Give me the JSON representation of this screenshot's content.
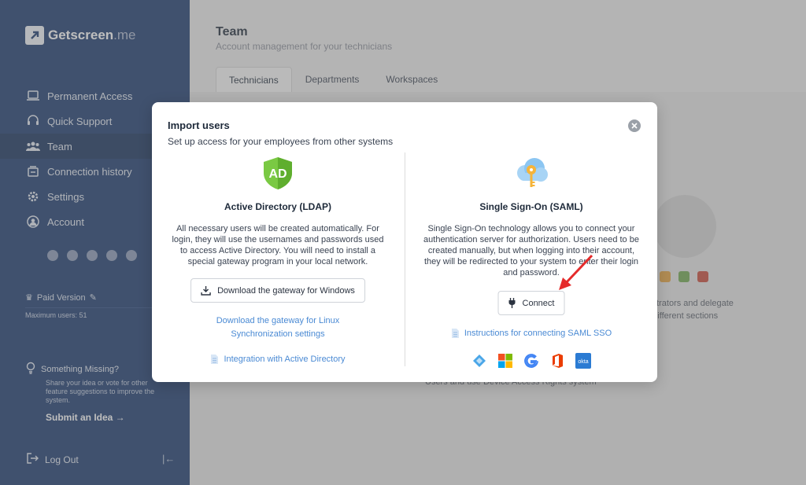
{
  "brand": {
    "name": "Getscreen",
    "suffix": ".me"
  },
  "sidebar": {
    "items": [
      {
        "label": "Permanent Access",
        "icon": "laptop-icon"
      },
      {
        "label": "Quick Support",
        "icon": "headset-icon"
      },
      {
        "label": "Team",
        "icon": "team-icon"
      },
      {
        "label": "Connection history",
        "icon": "history-icon"
      },
      {
        "label": "Settings",
        "icon": "gear-icon"
      },
      {
        "label": "Account",
        "icon": "user-circle-icon"
      }
    ],
    "paid_version": "Paid Version",
    "max_users": "Maximum users: 51",
    "missing_title": "Something Missing?",
    "missing_desc": "Share your idea or vote for other feature suggestions to improve the system.",
    "submit_idea": "Submit an Idea →",
    "logout": "Log Out"
  },
  "main": {
    "title": "Team",
    "subtitle": "Account management for your technicians",
    "tabs": [
      "Technicians",
      "Departments",
      "Workspaces"
    ],
    "bg_line1": "nistrators and delegate",
    "bg_line2": "n different sections",
    "bg_line3": "Users and use Device Access Rights system"
  },
  "modal": {
    "title": "Import users",
    "subtitle": "Set up access for your employees from other systems",
    "ldap": {
      "badge": "AD",
      "title": "Active Directory (LDAP)",
      "desc": "All necessary users will be created automatically. For login, they will use the usernames and passwords used to access Active Directory. You will need to install a special gateway program in your local network.",
      "download_btn": "Download the gateway for Windows",
      "linux_link": "Download the gateway for Linux",
      "sync_link": "Synchronization settings",
      "docs_link": "Integration with Active Directory"
    },
    "saml": {
      "title": "Single Sign-On (SAML)",
      "desc": "Single Sign-On technology allows you to connect your authentication server for authorization. Users need to be created manually, but when logging into their account, they will be redirected to your system to enter their login and password.",
      "connect_btn": "Connect",
      "docs_link": "Instructions for connecting SAML SSO",
      "providers": [
        "azure-icon",
        "microsoft-icon",
        "google-icon",
        "office-icon",
        "okta-icon"
      ],
      "okta_label": "okta"
    }
  },
  "colors": {
    "sidebar_bg": "#1b3a6e",
    "link": "#4a8ad4",
    "ad_green": "#7ac943",
    "arrow_red": "#e52b2b"
  }
}
